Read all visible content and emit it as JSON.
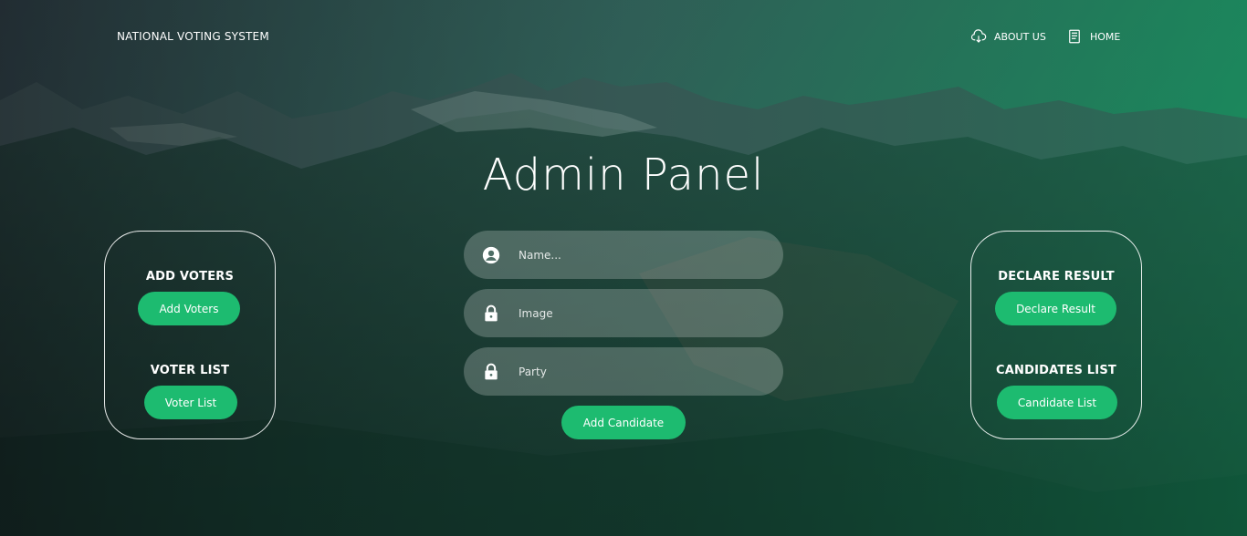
{
  "nav": {
    "brand": "NATIONAL VOTING SYSTEM",
    "about": "ABOUT US",
    "about_icon": "cloud-download-icon",
    "home": "HOME",
    "home_icon": "document-icon"
  },
  "main": {
    "title": "Admin Panel"
  },
  "left_panel": {
    "add_voters_heading": "ADD VOTERS",
    "add_voters_button": "Add Voters",
    "voter_list_heading": "VOTER LIST",
    "voter_list_button": "Voter List"
  },
  "right_panel": {
    "declare_heading": "DECLARE RESULT",
    "declare_button": "Declare Result",
    "candidates_heading": "CANDIDATES LIST",
    "candidates_button": "Candidate List"
  },
  "form": {
    "name_placeholder": "Name...",
    "name_icon": "user-circle-icon",
    "image_placeholder": "Image",
    "image_icon": "lock-icon",
    "party_placeholder": "Party",
    "party_icon": "lock-icon",
    "submit_label": "Add Candidate"
  },
  "colors": {
    "accent": "#1dbb70",
    "overlay": "#1a7a55"
  }
}
